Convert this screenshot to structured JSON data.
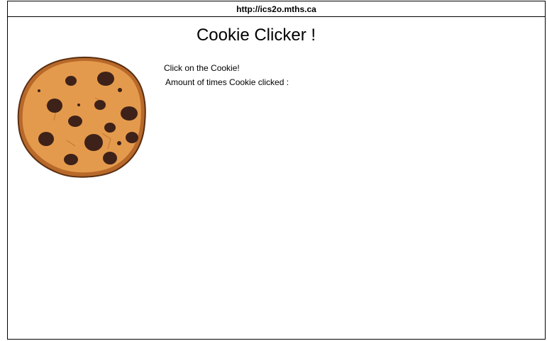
{
  "browser": {
    "url": "http://ics2o.mths.ca"
  },
  "page": {
    "title": "Cookie Clicker !",
    "instruction": "Click on the Cookie!",
    "counter_label": "Amount of times Cookie clicked :",
    "counter_value": ""
  },
  "cookie": {
    "icon": "cookie-icon",
    "dough_color": "#e49a4c",
    "edge_color": "#b8692a",
    "outline_color": "#5a2f12",
    "chip_color": "#3e2219"
  }
}
